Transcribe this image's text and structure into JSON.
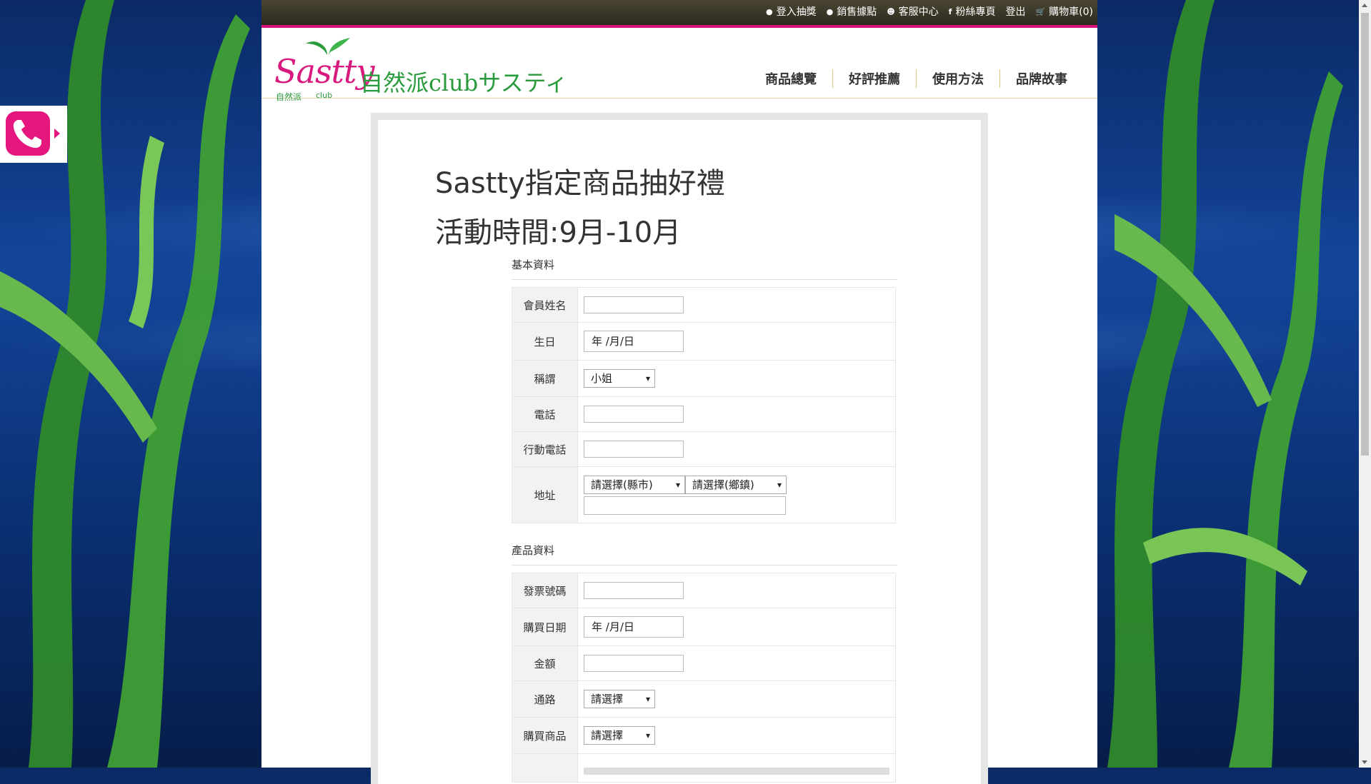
{
  "topbar": {
    "links": [
      {
        "icon": "location-pin-icon",
        "label": "登入抽獎"
      },
      {
        "icon": "location-pin-icon",
        "label": "銷售據點"
      },
      {
        "icon": "user-icon",
        "label": "客服中心"
      },
      {
        "icon": "facebook-icon",
        "label": "粉絲專頁"
      },
      {
        "icon": "",
        "label": "登出"
      },
      {
        "icon": "cart-icon",
        "label": "購物車(0)"
      }
    ]
  },
  "logo": {
    "brand": "Sastty",
    "jp": "自然派clubサスティ",
    "sub1": "自然派",
    "sub2": "club"
  },
  "nav": [
    "商品總覽",
    "好評推薦",
    "使用方法",
    "品牌故事"
  ],
  "title1": "Sastty指定商品抽好禮",
  "title2": "活動時間:9月-10月",
  "basic": {
    "heading": "基本資料",
    "name_label": "會員姓名",
    "birthday_label": "生日",
    "birthday_value": "年 /月/日",
    "title_label": "稱謂",
    "title_value": "小姐",
    "phone_label": "電話",
    "mobile_label": "行動電話",
    "address_label": "地址",
    "city_value": "請選擇(縣市)",
    "town_value": "請選擇(鄉鎮)"
  },
  "product": {
    "heading": "產品資料",
    "invoice_label": "發票號碼",
    "date_label": "購買日期",
    "date_value": "年 /月/日",
    "amount_label": "金額",
    "channel_label": "通路",
    "channel_value": "請選擇",
    "item_label": "購買商品",
    "item_value": "請選擇"
  },
  "colors": {
    "accent": "#d6137f",
    "green": "#2a9b3c"
  }
}
